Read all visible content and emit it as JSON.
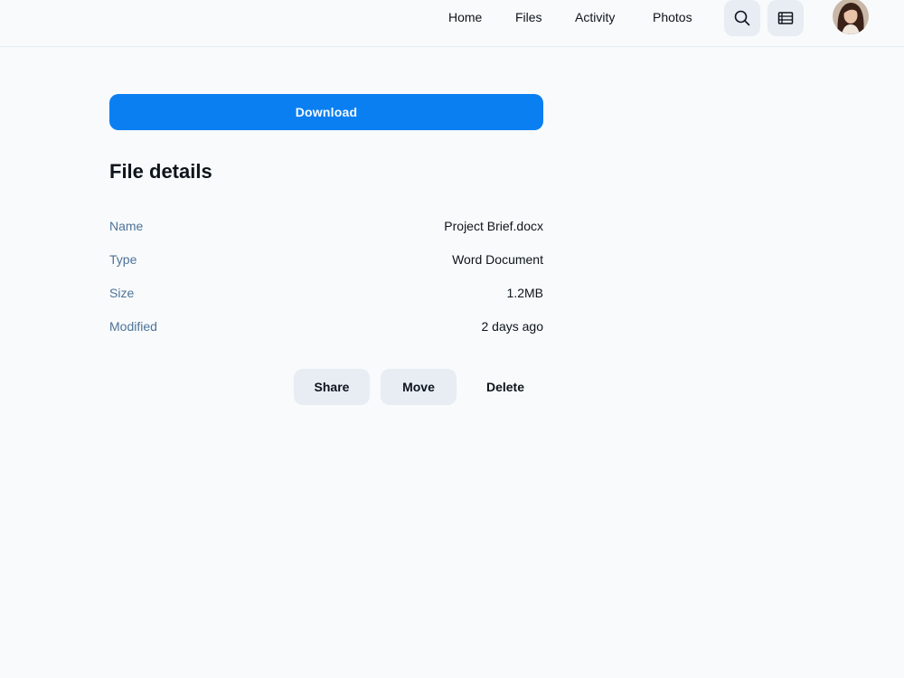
{
  "nav": {
    "links": [
      {
        "label": "Home"
      },
      {
        "label": "Files"
      },
      {
        "label": "Activity"
      },
      {
        "label": "Photos"
      }
    ],
    "search_icon": "search-icon",
    "menu_icon": "list-icon",
    "avatar": "user-avatar"
  },
  "main": {
    "download_label": "Download",
    "section_title": "File details",
    "details": [
      {
        "label": "Name",
        "value": "Project Brief.docx"
      },
      {
        "label": "Type",
        "value": "Word Document"
      },
      {
        "label": "Size",
        "value": "1.2MB"
      },
      {
        "label": "Modified",
        "value": "2 days ago"
      }
    ],
    "actions": {
      "share": "Share",
      "move": "Move",
      "delete": "Delete"
    }
  },
  "colors": {
    "accent": "#0a7ff2",
    "background": "#f8fafc",
    "secondary_button": "#e7edf3",
    "label_text": "#4e7397",
    "primary_text": "#0e141b"
  }
}
